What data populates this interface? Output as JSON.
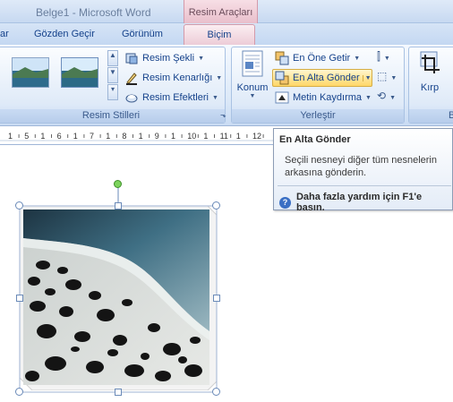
{
  "window": {
    "title": "Belge1 - Microsoft Word",
    "context_title": "Resim Araçları"
  },
  "tabs": [
    {
      "label": "ar"
    },
    {
      "label": "Gözden Geçir"
    },
    {
      "label": "Görünüm"
    },
    {
      "label": "Biçim"
    }
  ],
  "ribbon": {
    "styles_group": {
      "label": "Resim Stilleri",
      "commands": [
        "Resim Şekli",
        "Resim Kenarlığı",
        "Resim Efektleri"
      ]
    },
    "arrange_group": {
      "label": "Yerleştir",
      "position_label": "Konum",
      "commands": [
        "En Öne Getir",
        "En Alta Gönder",
        "Metin Kaydırma"
      ]
    },
    "size_group": {
      "crop_label": "Kırp",
      "label": "B"
    }
  },
  "ruler": {
    "labels": [
      "1",
      "5",
      "1",
      "6",
      "1",
      "7",
      "1",
      "8",
      "1",
      "9",
      "1",
      "10",
      "1",
      "11",
      "1",
      "12"
    ]
  },
  "tooltip": {
    "title": "En Alta Gönder",
    "body": "Seçili nesneyi diğer tüm nesnelerin arkasına gönderin.",
    "help": "Daha fazla yardım için F1'e basın."
  },
  "colors": {
    "accent": "#15428b",
    "context_tab": "#e9bfcc",
    "highlight": "#ffd768"
  }
}
